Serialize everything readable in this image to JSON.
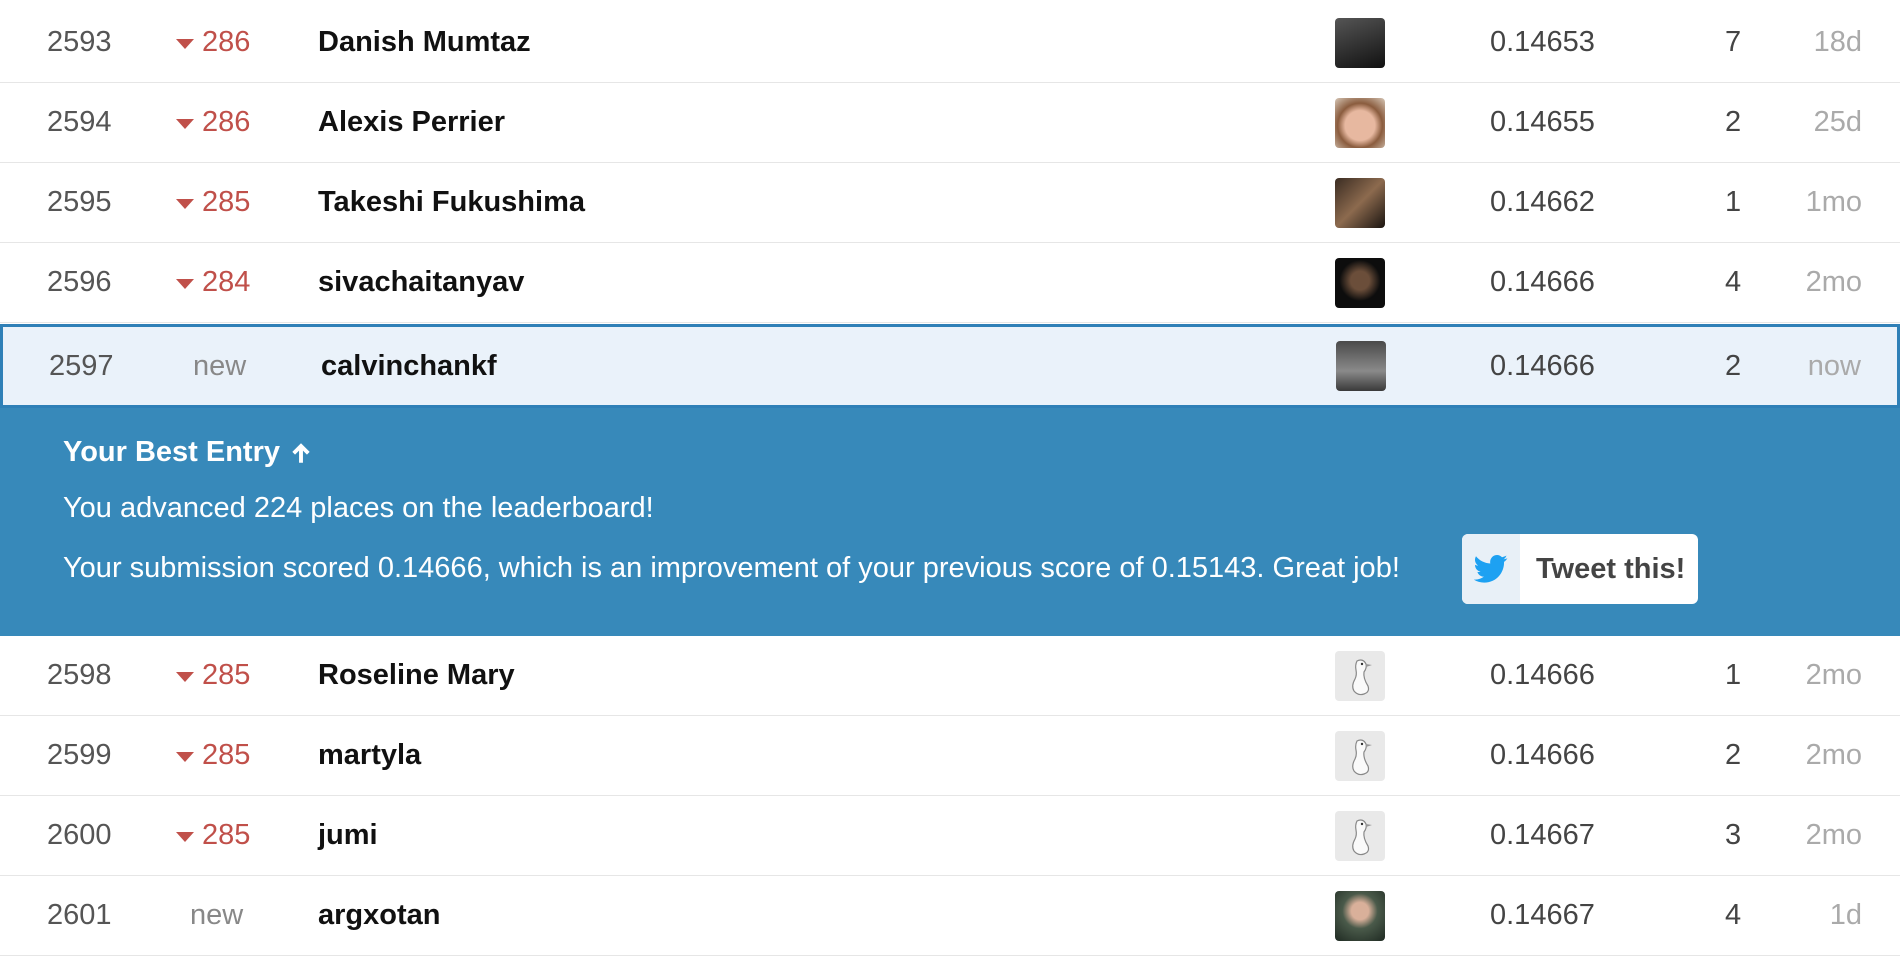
{
  "rows_before": [
    {
      "rank": "2593",
      "change": "286",
      "change_dir": "down",
      "team": "Danish Mumtaz",
      "avatar": "photo-dark",
      "score": "0.14653",
      "entries": "7",
      "last": "18d"
    },
    {
      "rank": "2594",
      "change": "286",
      "change_dir": "down",
      "team": "Alexis Perrier",
      "avatar": "photo-light",
      "score": "0.14655",
      "entries": "2",
      "last": "25d"
    },
    {
      "rank": "2595",
      "change": "285",
      "change_dir": "down",
      "team": "Takeshi Fukushima",
      "avatar": "photo-dark",
      "score": "0.14662",
      "entries": "1",
      "last": "1mo"
    },
    {
      "rank": "2596",
      "change": "284",
      "change_dir": "down",
      "team": "sivachaitanyav",
      "avatar": "photo-dark",
      "score": "0.14666",
      "entries": "4",
      "last": "2mo"
    }
  ],
  "current": {
    "rank": "2597",
    "change": "new",
    "team": "calvinchankf",
    "score": "0.14666",
    "entries": "2",
    "last": "now"
  },
  "banner": {
    "title": "Your Best Entry",
    "line1": "You advanced 224 places on the leaderboard!",
    "line2": "Your submission scored 0.14666, which is an improvement of your previous score of 0.15143. Great job!",
    "tweet_label": "Tweet this!"
  },
  "rows_after": [
    {
      "rank": "2598",
      "change": "285",
      "change_dir": "down",
      "team": "Roseline Mary",
      "avatar": "goose",
      "score": "0.14666",
      "entries": "1",
      "last": "2mo"
    },
    {
      "rank": "2599",
      "change": "285",
      "change_dir": "down",
      "team": "martyla",
      "avatar": "goose",
      "score": "0.14666",
      "entries": "2",
      "last": "2mo"
    },
    {
      "rank": "2600",
      "change": "285",
      "change_dir": "down",
      "team": "jumi",
      "avatar": "goose",
      "score": "0.14667",
      "entries": "3",
      "last": "2mo"
    },
    {
      "rank": "2601",
      "change": "new",
      "change_dir": "new",
      "team": "argxotan",
      "avatar": "photo-dark",
      "score": "0.14667",
      "entries": "4",
      "last": "1d"
    }
  ],
  "colors": {
    "banner": "#3789ba",
    "change_down": "#c0504a",
    "current_border": "#2f80b7"
  }
}
